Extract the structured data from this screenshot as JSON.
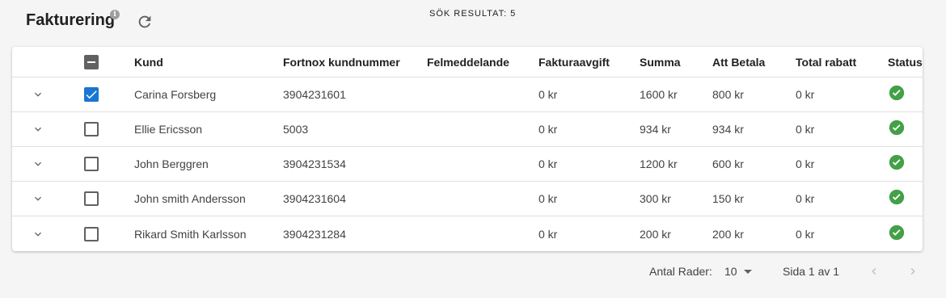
{
  "header": {
    "title": "Fakturering",
    "info_icon": "info-icon",
    "refresh_icon": "refresh-icon",
    "result_label": "SÖK RESULTAT: 5"
  },
  "table": {
    "columns": [
      "Kund",
      "Fortnox kundnummer",
      "Felmeddelande",
      "Fakturaavgift",
      "Summa",
      "Att Betala",
      "Total rabatt",
      "Status"
    ],
    "select_all_state": "indeterminate",
    "rows": [
      {
        "kund": "Carina Forsberg",
        "fortnox": "3904231601",
        "fel": "",
        "avgift": "0 kr",
        "summa": "1600 kr",
        "att": "800 kr",
        "rabatt": "0 kr",
        "status": "ok",
        "checked": true
      },
      {
        "kund": "Ellie Ericsson",
        "fortnox": "5003",
        "fel": "",
        "avgift": "0 kr",
        "summa": "934 kr",
        "att": "934 kr",
        "rabatt": "0 kr",
        "status": "ok",
        "checked": false
      },
      {
        "kund": "John Berggren",
        "fortnox": "3904231534",
        "fel": "",
        "avgift": "0 kr",
        "summa": "1200 kr",
        "att": "600 kr",
        "rabatt": "0 kr",
        "status": "ok",
        "checked": false
      },
      {
        "kund": "John smith Andersson",
        "fortnox": "3904231604",
        "fel": "",
        "avgift": "0 kr",
        "summa": "300 kr",
        "att": "150 kr",
        "rabatt": "0 kr",
        "status": "ok",
        "checked": false
      },
      {
        "kund": "Rikard Smith Karlsson",
        "fortnox": "3904231284",
        "fel": "",
        "avgift": "0 kr",
        "summa": "200 kr",
        "att": "200 kr",
        "rabatt": "0 kr",
        "status": "ok",
        "checked": false
      }
    ]
  },
  "footer": {
    "rows_label": "Antal Rader:",
    "rows_value": "10",
    "page_label": "Sida 1 av 1",
    "prev_icon": "chevron-left-icon",
    "next_icon": "chevron-right-icon"
  },
  "colors": {
    "accent": "#1976d2",
    "success": "#43a047",
    "icon_gray": "#616161"
  }
}
